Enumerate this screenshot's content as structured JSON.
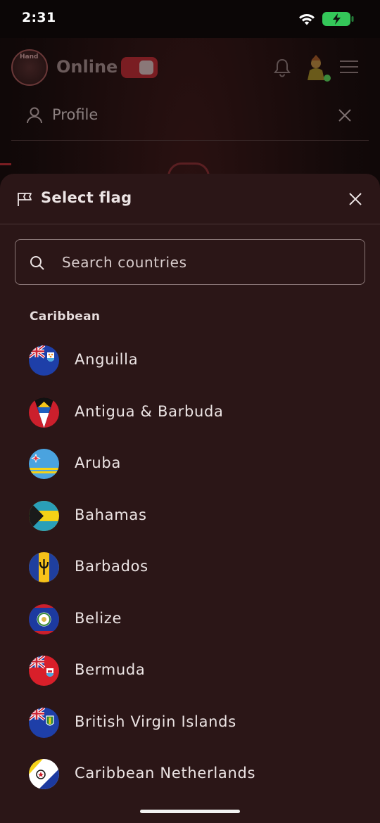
{
  "status_bar": {
    "time": "2:31"
  },
  "background_app": {
    "logo_text": "Hand",
    "mode_label": "Online",
    "profile_title": "Profile"
  },
  "sheet": {
    "title": "Select flag",
    "search": {
      "placeholder": "Search countries",
      "value": ""
    },
    "section": "Caribbean",
    "countries": [
      {
        "name": "Anguilla",
        "flag": "anguilla-flag-icon"
      },
      {
        "name": "Antigua & Barbuda",
        "flag": "antigua-barbuda-flag-icon"
      },
      {
        "name": "Aruba",
        "flag": "aruba-flag-icon"
      },
      {
        "name": "Bahamas",
        "flag": "bahamas-flag-icon"
      },
      {
        "name": "Barbados",
        "flag": "barbados-flag-icon"
      },
      {
        "name": "Belize",
        "flag": "belize-flag-icon"
      },
      {
        "name": "Bermuda",
        "flag": "bermuda-flag-icon"
      },
      {
        "name": "British Virgin Islands",
        "flag": "british-virgin-islands-flag-icon"
      },
      {
        "name": "Caribbean Netherlands",
        "flag": "caribbean-netherlands-flag-icon"
      }
    ]
  },
  "colors": {
    "sheet_background": "#2b1617",
    "toggle_accent": "#7a1d22",
    "text_primary": "#ece4e4",
    "battery_green": "#34c759"
  }
}
